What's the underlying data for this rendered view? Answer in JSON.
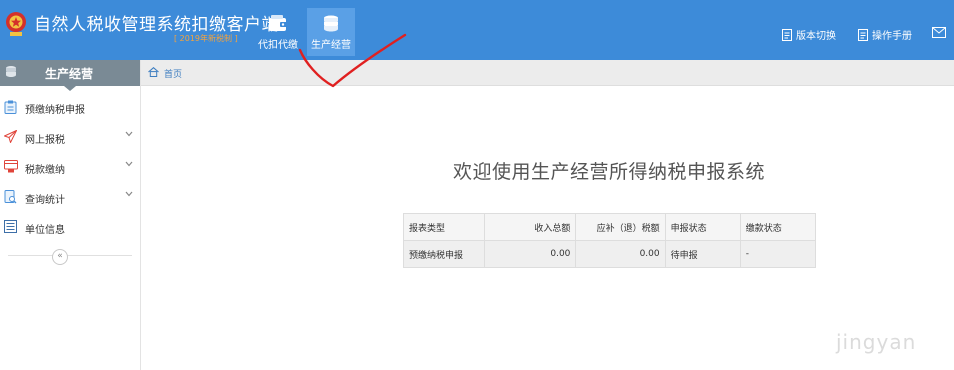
{
  "header": {
    "title": "自然人税收管理系统扣缴客户端",
    "subtitle": "[ 2019年新税制 ]",
    "tabs": [
      {
        "label": "代扣代缴",
        "icon": "wallet-icon",
        "active": false
      },
      {
        "label": "生产经营",
        "icon": "coins-icon",
        "active": true
      }
    ],
    "links": [
      {
        "label": "版本切换",
        "icon": "document-icon"
      },
      {
        "label": "操作手册",
        "icon": "document-icon"
      },
      {
        "label": "",
        "icon": "mail-icon"
      }
    ]
  },
  "sidebar": {
    "heading": "生产经营",
    "items": [
      {
        "label": "预缴纳税申报",
        "icon": "clipboard-icon",
        "expandable": false,
        "active": true
      },
      {
        "label": "网上报税",
        "icon": "send-icon",
        "expandable": true
      },
      {
        "label": "税款缴纳",
        "icon": "payment-icon",
        "expandable": true
      },
      {
        "label": "查询统计",
        "icon": "query-icon",
        "expandable": true
      },
      {
        "label": "单位信息",
        "icon": "list-icon",
        "expandable": false
      }
    ],
    "collapse_label": "«"
  },
  "breadcrumb": {
    "label": "首页",
    "icon": "home-icon"
  },
  "main": {
    "welcome": "欢迎使用生产经营所得纳税申报系统",
    "table": {
      "headers": [
        "报表类型",
        "收入总额",
        "应补（退）税额",
        "申报状态",
        "缴款状态"
      ],
      "rows": [
        [
          "预缴纳税申报",
          "0.00",
          "0.00",
          "待申报",
          "-"
        ]
      ]
    }
  },
  "watermark": "jingyan",
  "colors": {
    "header_bg": "#3d8bd9",
    "active_tab_bg": "#5aa0e6",
    "subtitle": "#f4a33d",
    "sidebar_head_bg": "#7a8a95",
    "annotation": "#e02020"
  }
}
